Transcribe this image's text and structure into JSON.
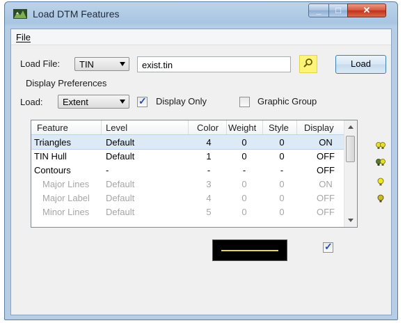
{
  "window": {
    "title": "Load DTM Features"
  },
  "menu": {
    "file": "File"
  },
  "load_file": {
    "label": "Load File:",
    "type_value": "TIN",
    "file_value": "exist.tin",
    "load_button": "Load"
  },
  "display_prefs": {
    "group_label": "Display Preferences",
    "load_label": "Load:",
    "load_value": "Extent",
    "display_only_label": "Display Only",
    "display_only_checked": true,
    "graphic_group_label": "Graphic Group",
    "graphic_group_checked": false
  },
  "table": {
    "columns": [
      "Feature",
      "Level",
      "Color",
      "Weight",
      "Style",
      "Display"
    ],
    "rows": [
      {
        "feature": "Triangles",
        "level": "Default",
        "color": "4",
        "weight": "0",
        "style": "0",
        "display": "ON"
      },
      {
        "feature": "TIN Hull",
        "level": "Default",
        "color": "1",
        "weight": "0",
        "style": "0",
        "display": "OFF"
      },
      {
        "feature": "Contours",
        "level": "-",
        "color": "-",
        "weight": "-",
        "style": "-",
        "display": "OFF"
      },
      {
        "feature": "Major Lines",
        "level": "Default",
        "color": "3",
        "weight": "0",
        "style": "0",
        "display": "ON"
      },
      {
        "feature": "Major Label",
        "level": "Default",
        "color": "4",
        "weight": "0",
        "style": "0",
        "display": "OFF"
      },
      {
        "feature": "Minor Lines",
        "level": "Default",
        "color": "5",
        "weight": "0",
        "style": "0",
        "display": "OFF"
      }
    ]
  },
  "preview": {
    "line_color": "#e3d74c",
    "checkbox_checked": true
  },
  "colors": {
    "accent": "#3c7fb1",
    "selection": "#dce9f7",
    "highlight_yellow": "#fff47a"
  }
}
